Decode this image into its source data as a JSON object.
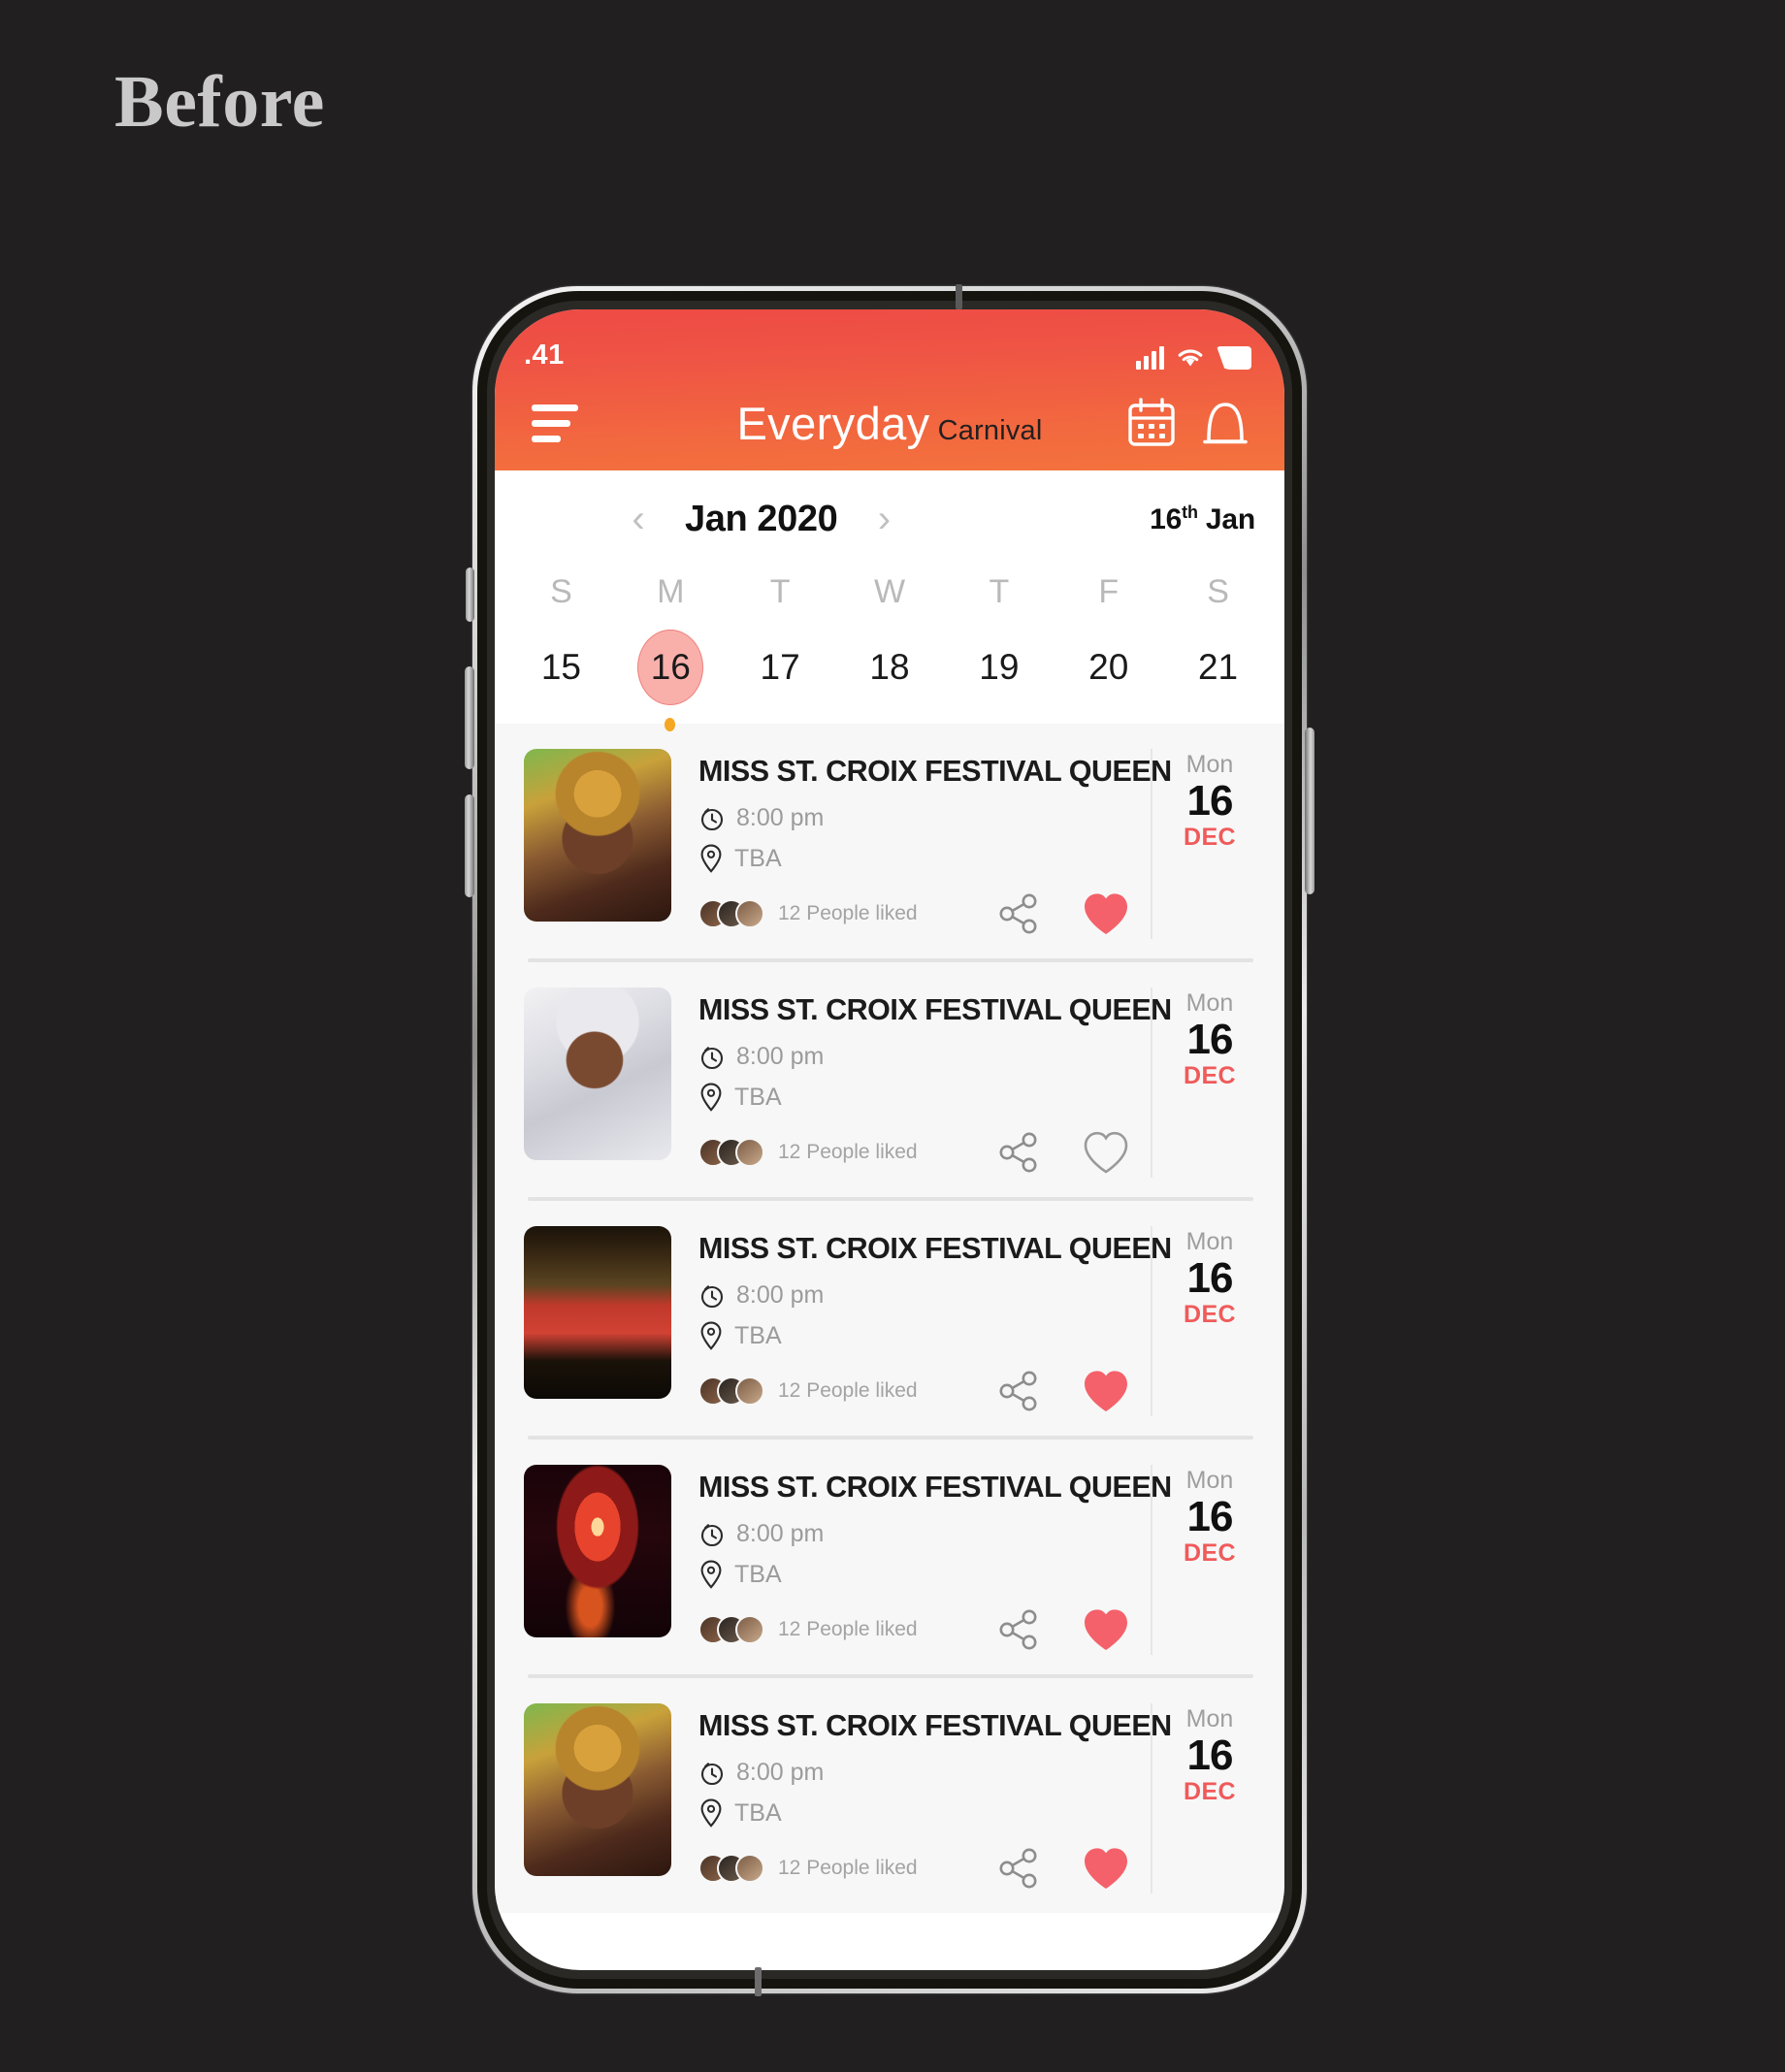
{
  "annotation": {
    "label": "Before"
  },
  "status_bar": {
    "time": ".41",
    "signal_icon": "cellular-signal-icon",
    "wifi_icon": "wifi-icon",
    "battery_icon": "battery-icon"
  },
  "nav": {
    "menu_icon": "hamburger-menu-icon",
    "brand_primary": "Everyday",
    "brand_secondary": "Carnival",
    "calendar_icon": "calendar-icon",
    "bell_icon": "bell-notification-icon"
  },
  "calendar": {
    "prev_icon": "chevron-left-icon",
    "next_icon": "chevron-right-icon",
    "month_title": "Jan 2020",
    "today_day": "16",
    "today_suffix": "th",
    "today_month": "Jan",
    "day_labels": [
      "S",
      "M",
      "T",
      "W",
      "T",
      "F",
      "S"
    ],
    "dates": [
      "15",
      "16",
      "17",
      "18",
      "19",
      "20",
      "21"
    ],
    "selected_index": 1,
    "has_event_dot_index": 1
  },
  "colors": {
    "header_top": "#ee4a45",
    "header_bottom": "#f4733d",
    "accent_red": "#f05a5a",
    "selected_pill": "#f9b0ab",
    "event_dot": "#f5a623",
    "page_background": "#211F1F",
    "list_background": "#f7f7f7"
  },
  "events": [
    {
      "title": "MISS ST. CROIX FESTIVAL QUEEN",
      "time": "8:00 pm",
      "location": "TBA",
      "liked_text": "12 People liked",
      "day_of_week": "Mon",
      "day_number": "16",
      "month": "DEC",
      "liked": true,
      "thumbnail": "carnival-queen-gold-headdress",
      "clock_icon": "clock-icon",
      "pin_icon": "location-pin-icon",
      "share_icon": "share-icon",
      "heart_icon": "heart-filled-icon"
    },
    {
      "title": "MISS ST. CROIX FESTIVAL QUEEN",
      "time": "8:00 pm",
      "location": "TBA",
      "liked_text": "12 People liked",
      "day_of_week": "Mon",
      "day_number": "16",
      "month": "DEC",
      "liked": false,
      "thumbnail": "carnival-queen-white-costume",
      "clock_icon": "clock-icon",
      "pin_icon": "location-pin-icon",
      "share_icon": "share-icon",
      "heart_icon": "heart-outline-icon"
    },
    {
      "title": "MISS ST. CROIX FESTIVAL QUEEN",
      "time": "8:00 pm",
      "location": "TBA",
      "liked_text": "12 People liked",
      "day_of_week": "Mon",
      "day_number": "16",
      "month": "DEC",
      "liked": true,
      "thumbnail": "choir-red-robes-cathedral",
      "clock_icon": "clock-icon",
      "pin_icon": "location-pin-icon",
      "share_icon": "share-icon",
      "heart_icon": "heart-filled-icon"
    },
    {
      "title": "MISS ST. CROIX FESTIVAL QUEEN",
      "time": "8:00 pm",
      "location": "TBA",
      "liked_text": "12 People liked",
      "day_of_week": "Mon",
      "day_number": "16",
      "month": "DEC",
      "liked": true,
      "thumbnail": "red-fireworks-night",
      "clock_icon": "clock-icon",
      "pin_icon": "location-pin-icon",
      "share_icon": "share-icon",
      "heart_icon": "heart-filled-icon"
    },
    {
      "title": "MISS ST. CROIX FESTIVAL QUEEN",
      "time": "8:00 pm",
      "location": "TBA",
      "liked_text": "12 People liked",
      "day_of_week": "Mon",
      "day_number": "16",
      "month": "DEC",
      "liked": true,
      "thumbnail": "carnival-queen-gold-headdress",
      "clock_icon": "clock-icon",
      "pin_icon": "location-pin-icon",
      "share_icon": "share-icon",
      "heart_icon": "heart-filled-icon"
    }
  ]
}
